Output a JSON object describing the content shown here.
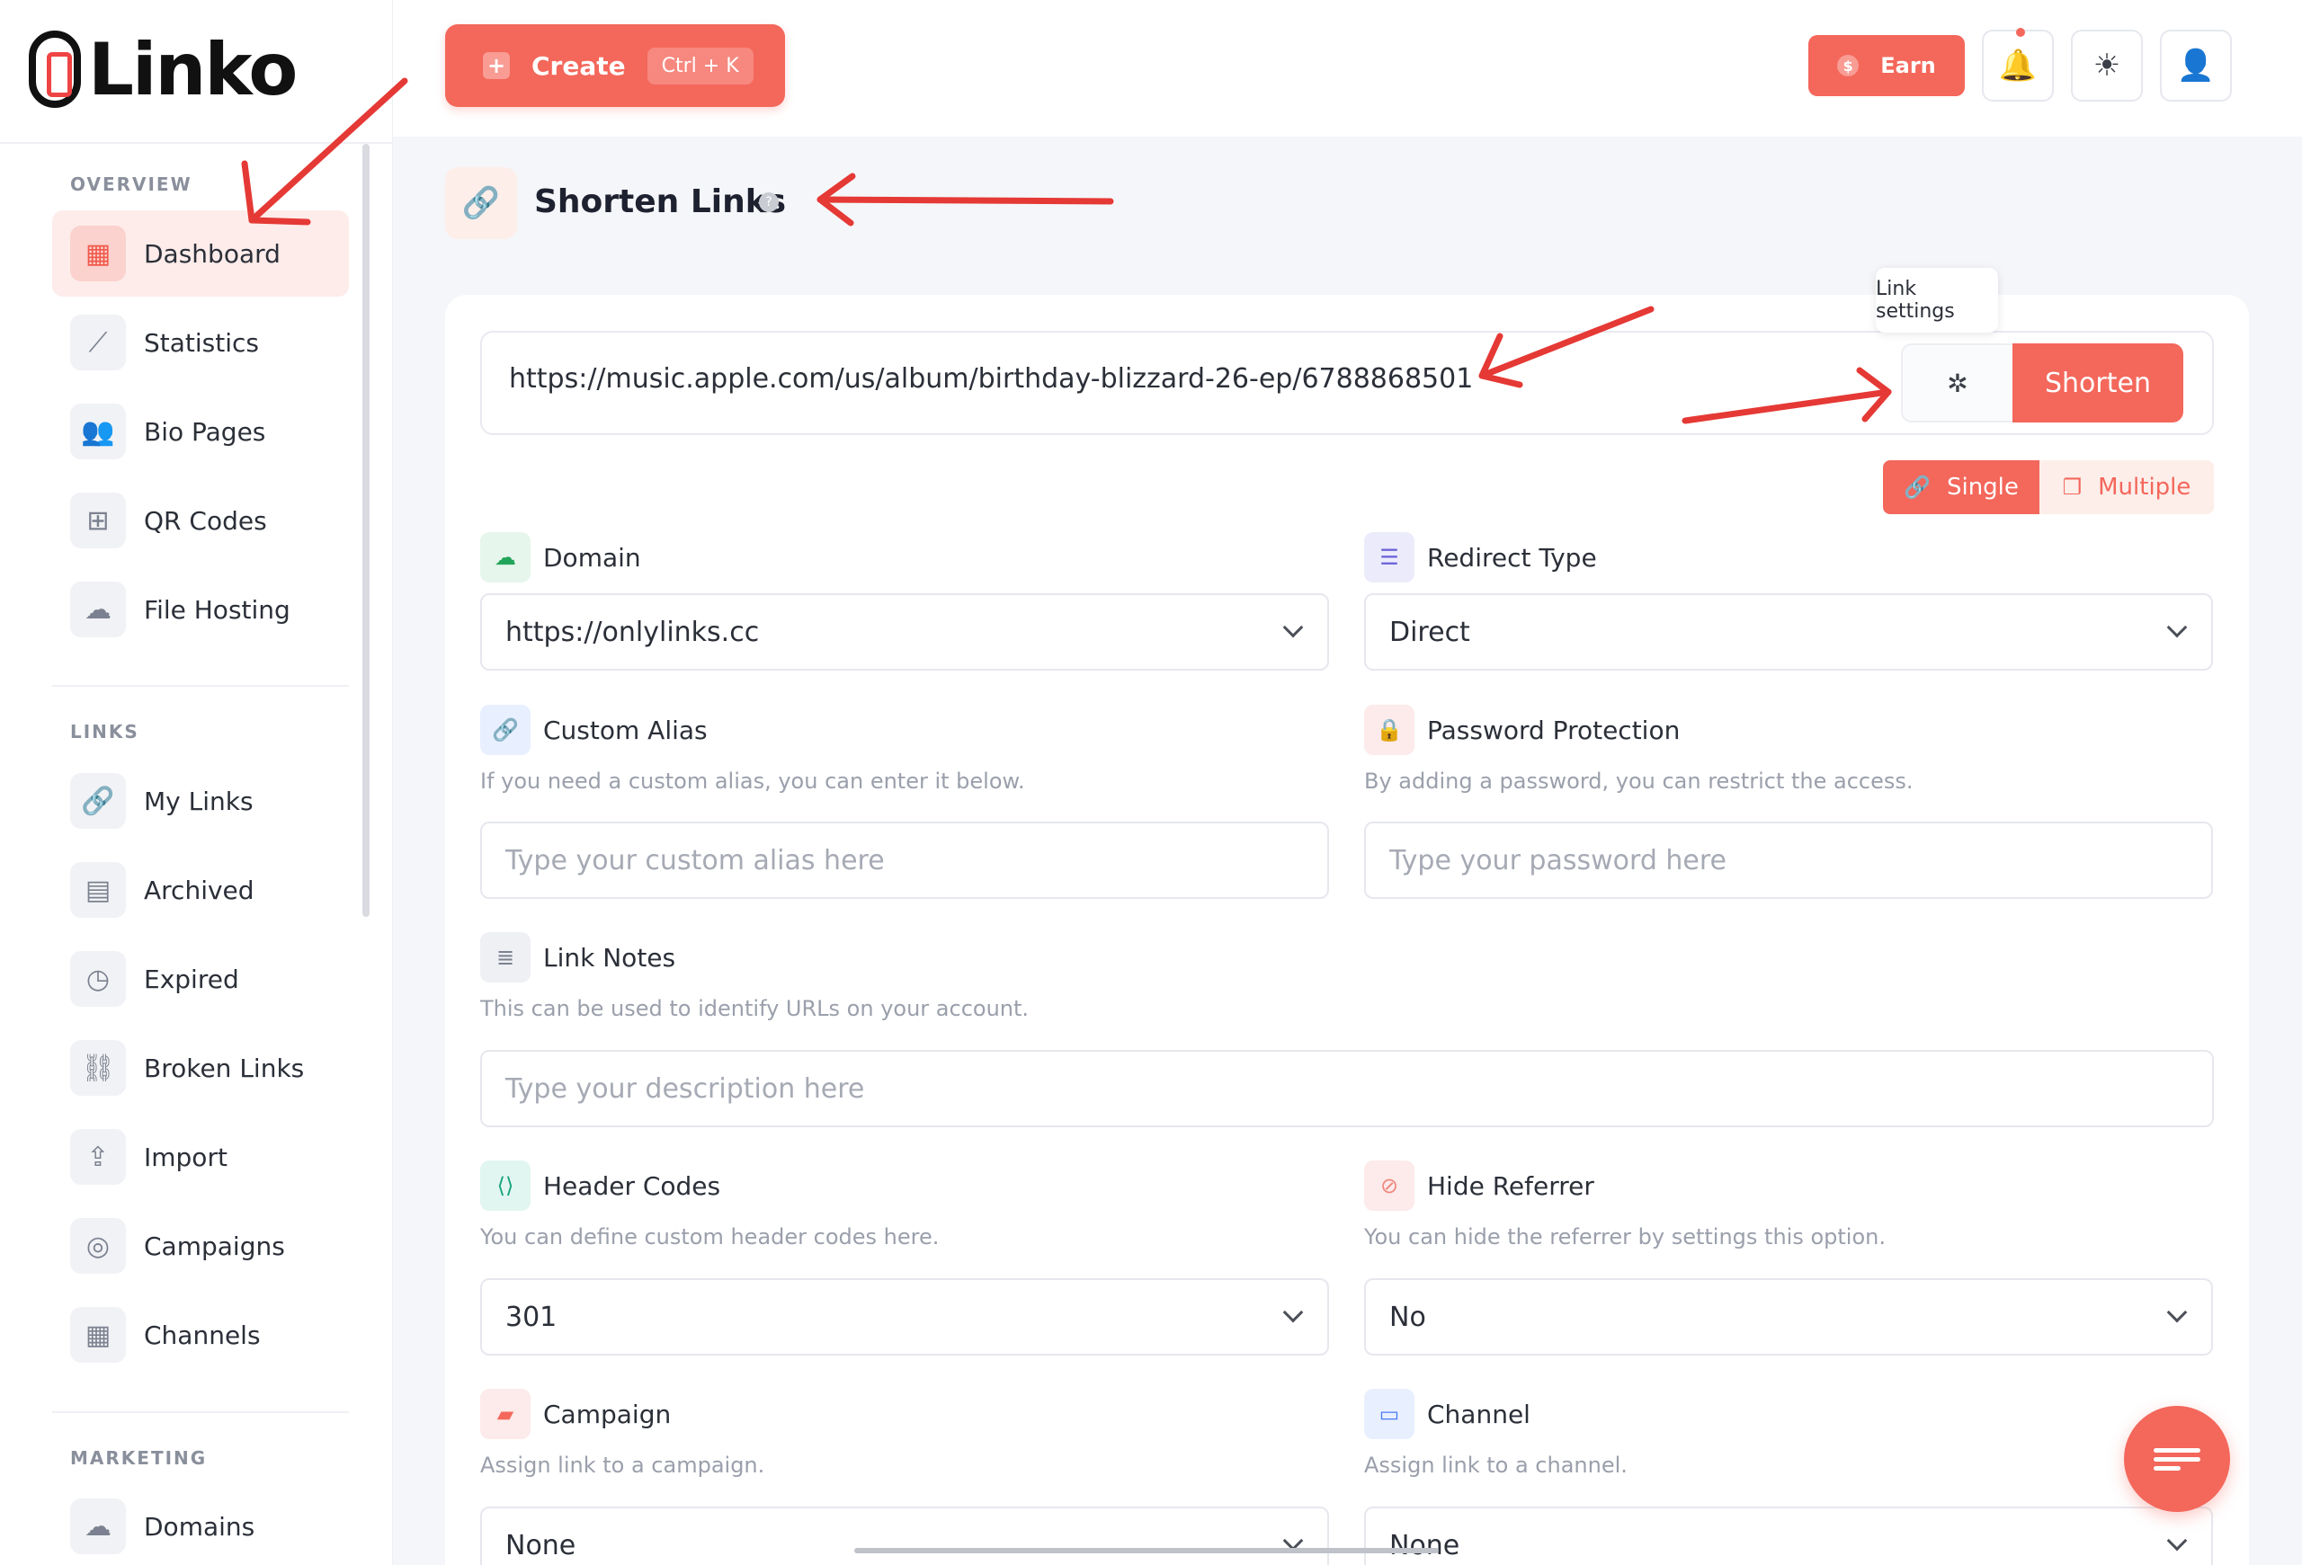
{
  "app": {
    "logo_text": "Linko"
  },
  "sidebar": {
    "sections": [
      {
        "label": "OVERVIEW"
      },
      {
        "label": "LINKS"
      },
      {
        "label": "MARKETING"
      }
    ],
    "items": [
      {
        "label": "Dashboard",
        "icon": "grid-icon",
        "active": true
      },
      {
        "label": "Statistics",
        "icon": "chart-icon"
      },
      {
        "label": "Bio Pages",
        "icon": "users-icon"
      },
      {
        "label": "QR Codes",
        "icon": "qr-icon"
      },
      {
        "label": "File Hosting",
        "icon": "cloud-icon"
      },
      {
        "label": "My Links",
        "icon": "link-icon"
      },
      {
        "label": "Archived",
        "icon": "archive-icon"
      },
      {
        "label": "Expired",
        "icon": "clock-icon"
      },
      {
        "label": "Broken Links",
        "icon": "broken-link-icon"
      },
      {
        "label": "Import",
        "icon": "import-icon"
      },
      {
        "label": "Campaigns",
        "icon": "target-icon"
      },
      {
        "label": "Channels",
        "icon": "grid-icon"
      },
      {
        "label": "Domains",
        "icon": "cloud-icon"
      }
    ]
  },
  "topbar": {
    "create_label": "Create",
    "create_shortcut": "Ctrl + K",
    "earn_label": "Earn"
  },
  "page": {
    "title": "Shorten Links",
    "help": "?"
  },
  "shortener": {
    "url_value": "https://music.apple.com/us/album/birthday-blizzard-26-ep/6788868501",
    "tooltip": "Link settings",
    "shorten_label": "Shorten",
    "mode_single": "Single",
    "mode_multiple": "Multiple"
  },
  "form": {
    "domain": {
      "label": "Domain",
      "value": "https://onlylinks.cc"
    },
    "redirect_type": {
      "label": "Redirect Type",
      "value": "Direct"
    },
    "custom_alias": {
      "label": "Custom Alias",
      "description": "If you need a custom alias, you can enter it below.",
      "placeholder": "Type your custom alias here"
    },
    "password": {
      "label": "Password Protection",
      "description": "By adding a password, you can restrict the access.",
      "placeholder": "Type your password here"
    },
    "notes": {
      "label": "Link Notes",
      "description": "This can be used to identify URLs on your account.",
      "placeholder": "Type your description here"
    },
    "header_codes": {
      "label": "Header Codes",
      "description": "You can define custom header codes here.",
      "value": "301"
    },
    "hide_referrer": {
      "label": "Hide Referrer",
      "description": "You can hide the referrer by settings this option.",
      "value": "No"
    },
    "campaign": {
      "label": "Campaign",
      "description": "Assign link to a campaign.",
      "value": "None"
    },
    "channel": {
      "label": "Channel",
      "description": "Assign link to a channel.",
      "value": "None"
    }
  },
  "colors": {
    "accent": "#f4675b",
    "annotation_arrow": "#e53935"
  }
}
